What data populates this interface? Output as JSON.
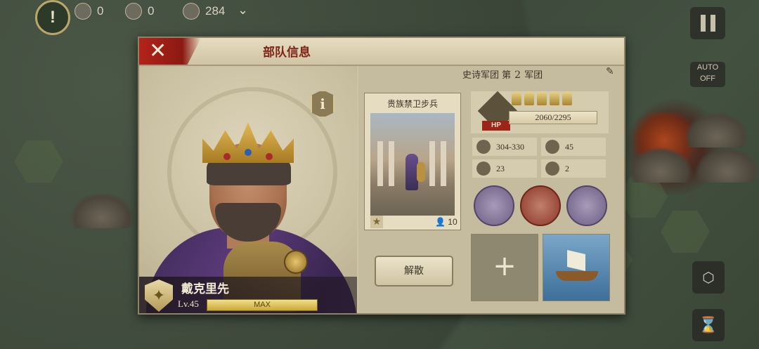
{
  "hud": {
    "alert_label": "!",
    "res1": "0",
    "res2": "0",
    "res3": "284",
    "pause_icon": "pause-icon",
    "auto_label": "AUTO",
    "auto_sub": "OFF"
  },
  "dialog": {
    "title": "部队信息",
    "close_label": "✕",
    "info_label": "i"
  },
  "general": {
    "name": "戴克里先",
    "level": "Lv.45",
    "max": "MAX"
  },
  "legion": {
    "prefix": "史诗军团 第",
    "number": "2",
    "suffix": "军团"
  },
  "unit": {
    "name": "贵族禁卫步兵",
    "count": "10",
    "hp_tag": "HP",
    "hp": "2060/2295",
    "attack": "304-330",
    "defense": "45",
    "move": "23",
    "vision": "2"
  },
  "buttons": {
    "disband": "解散",
    "add": "+"
  }
}
